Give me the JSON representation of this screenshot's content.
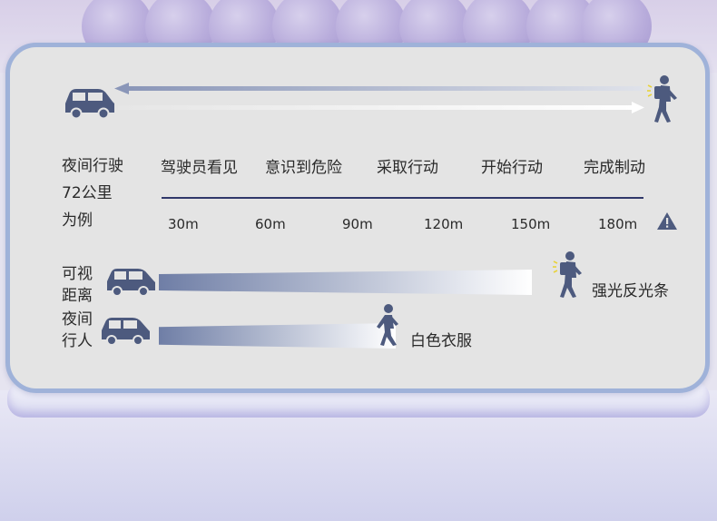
{
  "intro": {
    "line1": "夜间行驶",
    "line2": "72公里",
    "line3": "为例"
  },
  "stages": [
    "驾驶员看见",
    "意识到危险",
    "采取行动",
    "开始行动",
    "完成制动"
  ],
  "distances": [
    "30m",
    "60m",
    "90m",
    "120m",
    "150m",
    "180m"
  ],
  "rows": [
    {
      "label_line1": "可视",
      "label_line2": "距离",
      "caption": "强光反光条",
      "beam_end_m": 150
    },
    {
      "label_line1": "夜间",
      "label_line2": "行人",
      "caption": "白色衣服",
      "beam_end_m": 90
    }
  ],
  "icons": {
    "car": "car-icon",
    "pedestrian": "walking-person-icon",
    "warning": "warning-triangle-icon",
    "reflective": "reflective-backpack-person-icon"
  },
  "colors": {
    "icon": "#4d5a7e",
    "beam_start": "#6f7ea6",
    "card_bg": "#e4e4e4",
    "card_border": "#9fb2d9",
    "reflect": "#e8d23a"
  }
}
